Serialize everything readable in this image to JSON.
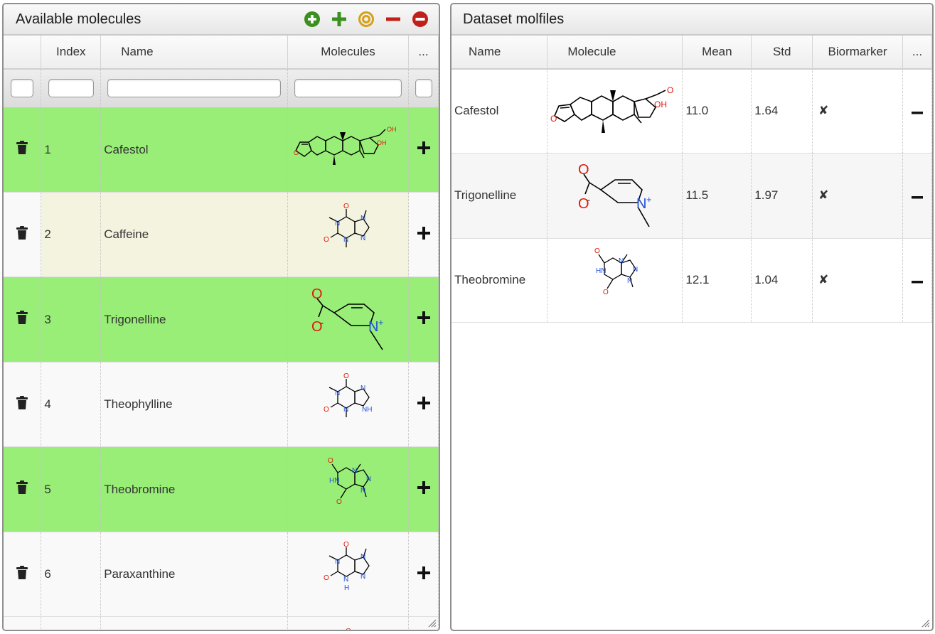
{
  "left_panel": {
    "title": "Available molecules",
    "toolbar": [
      "add-circle-icon",
      "plus-icon",
      "target-icon",
      "minus-icon",
      "remove-circle-icon"
    ],
    "columns": [
      "Index",
      "Name",
      "Molecules",
      "..."
    ],
    "rows": [
      {
        "index": "1",
        "name": "Cafestol",
        "structure": "cafestol-structure",
        "highlight": "green"
      },
      {
        "index": "2",
        "name": "Caffeine",
        "structure": "caffeine-structure",
        "highlight": "hover"
      },
      {
        "index": "3",
        "name": "Trigonelline",
        "structure": "trigonelline-structure",
        "highlight": "green"
      },
      {
        "index": "4",
        "name": "Theophylline",
        "structure": "theophylline-structure",
        "highlight": "none"
      },
      {
        "index": "5",
        "name": "Theobromine",
        "structure": "theobromine-structure",
        "highlight": "green"
      },
      {
        "index": "6",
        "name": "Paraxanthine",
        "structure": "paraxanthine-structure",
        "highlight": "none"
      }
    ]
  },
  "right_panel": {
    "title": "Dataset molfiles",
    "columns": [
      "Name",
      "Molecule",
      "Mean",
      "Std",
      "Biormarker",
      "..."
    ],
    "rows": [
      {
        "name": "Cafestol",
        "structure": "cafestol-structure",
        "mean": "11.0",
        "std": "1.64",
        "biomarker": "✘"
      },
      {
        "name": "Trigonelline",
        "structure": "trigonelline-structure",
        "mean": "11.5",
        "std": "1.97",
        "biomarker": "✘"
      },
      {
        "name": "Theobromine",
        "structure": "theobromine-structure",
        "mean": "12.1",
        "std": "1.04",
        "biomarker": "✘"
      }
    ]
  },
  "atom_labels": {
    "O": "O",
    "OH": "OH",
    "N": "N",
    "NH": "NH",
    "HN": "HN",
    "H": "H",
    "N_plus": "+",
    "O_minus": "-"
  },
  "colors": {
    "green_row": "#99ee77",
    "hover_row": "#f4f3df",
    "oxygen": "#e0190d",
    "nitrogen": "#1f4fd8",
    "add_icon": "#3a8f1f",
    "target_icon": "#d6a01a",
    "remove_icon": "#c0201a",
    "cross_mark": "#e4330e"
  }
}
